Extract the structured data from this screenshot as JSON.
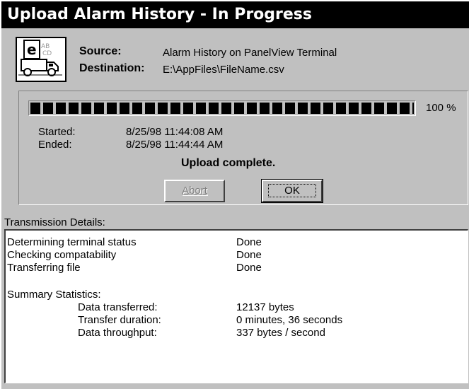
{
  "window": {
    "title": "Upload Alarm History - In Progress"
  },
  "icon": {
    "name": "upload-truck-icon",
    "letter": "e"
  },
  "source": {
    "label": "Source:",
    "value": "Alarm History on PanelView Terminal"
  },
  "destination": {
    "label": "Destination:",
    "value": "E:\\AppFiles\\FileName.csv"
  },
  "progress": {
    "fraction": 1.0,
    "percent_text": "100 %"
  },
  "times": {
    "started_label": "Started:",
    "started_value": "8/25/98 11:44:08 AM",
    "ended_label": "Ended:",
    "ended_value": "8/25/98 11:44:44 AM"
  },
  "status": "Upload complete.",
  "buttons": {
    "abort": "Abort",
    "ok": "OK"
  },
  "details": {
    "label": "Transmission Details:",
    "steps": [
      {
        "name": "Determining terminal status",
        "status": "Done"
      },
      {
        "name": "Checking compatability",
        "status": "Done"
      },
      {
        "name": "Transferring file",
        "status": "Done"
      }
    ],
    "summary_title": "Summary Statistics:",
    "stats": [
      {
        "name": "Data transferred:",
        "value": "12137 bytes"
      },
      {
        "name": "Transfer duration:",
        "value": "0 minutes, 36 seconds"
      },
      {
        "name": "Data throughput:",
        "value": "337 bytes / second"
      }
    ]
  }
}
